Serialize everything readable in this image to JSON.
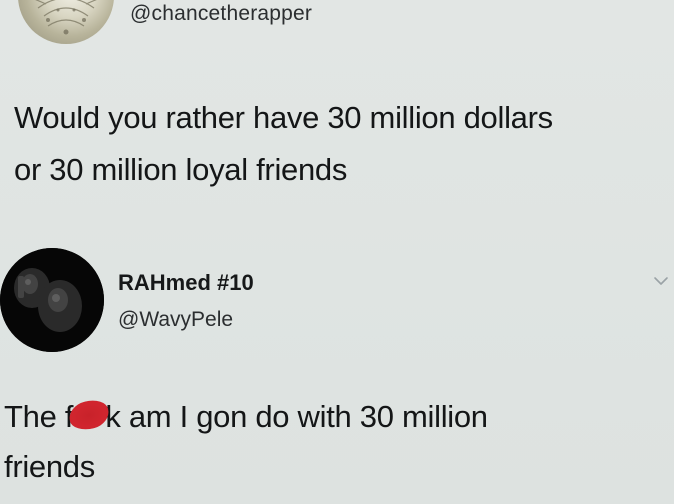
{
  "quoted_tweet": {
    "handle": "@chancetherapper",
    "text_line1": "Would you rather have 30 million dollars",
    "text_line2": "or 30 million loyal friends"
  },
  "reply_tweet": {
    "display_name": "RAHmed #10",
    "handle": "@WavyPele",
    "text_part1": "The f",
    "text_part2": "k am I gon do with 30 million",
    "text_line2": "friends",
    "menu_icon": "chevron-down-icon",
    "censor_color": "#d0252e"
  }
}
